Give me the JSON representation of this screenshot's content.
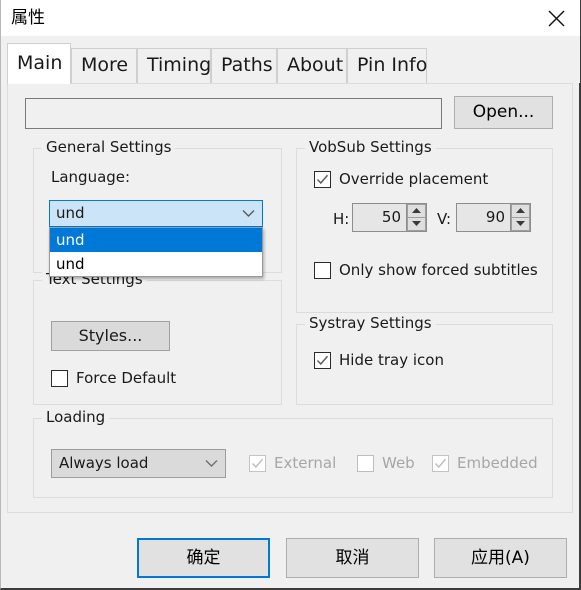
{
  "window": {
    "title": "属性",
    "close_icon": "close-icon"
  },
  "tabs": [
    {
      "label": "Main",
      "active": true
    },
    {
      "label": "More",
      "active": false
    },
    {
      "label": "Timing",
      "active": false
    },
    {
      "label": "Paths",
      "active": false
    },
    {
      "label": "About",
      "active": false
    },
    {
      "label": "Pin Info",
      "active": false
    }
  ],
  "main": {
    "path_field": {
      "value": "",
      "placeholder": ""
    },
    "open_button": "Open...",
    "general_settings": {
      "title": "General Settings",
      "language_label": "Language:",
      "language_value": "und",
      "dropdown_open": true,
      "dropdown_options": [
        {
          "label": "und",
          "selected": true
        },
        {
          "label": "und",
          "selected": false
        }
      ]
    },
    "text_settings": {
      "title": "Text Settings",
      "styles_button": "Styles...",
      "force_default": {
        "label": "Force Default",
        "checked": false
      }
    },
    "vobsub_settings": {
      "title": "VobSub Settings",
      "override_placement": {
        "label": "Override placement",
        "checked": true
      },
      "h_label": "H:",
      "h_value": "50",
      "v_label": "V:",
      "v_value": "90",
      "only_forced": {
        "label": "Only show forced subtitles",
        "checked": false
      }
    },
    "systray_settings": {
      "title": "Systray Settings",
      "hide_tray_icon": {
        "label": "Hide tray icon",
        "checked": true
      }
    },
    "loading": {
      "title": "Loading",
      "mode_value": "Always load",
      "external": {
        "label": "External",
        "checked": true,
        "disabled": true
      },
      "web": {
        "label": "Web",
        "checked": false,
        "disabled": true
      },
      "embedded": {
        "label": "Embedded",
        "checked": true,
        "disabled": true
      }
    }
  },
  "footer": {
    "ok": "确定",
    "cancel": "取消",
    "apply": "应用(A)"
  },
  "colors": {
    "accent": "#0078d7",
    "dialog_bg": "#f0f0f0",
    "button_bg": "#e1e1e1",
    "selection_bg": "#0078d7",
    "combo_focus_bg": "#cce4f7"
  }
}
